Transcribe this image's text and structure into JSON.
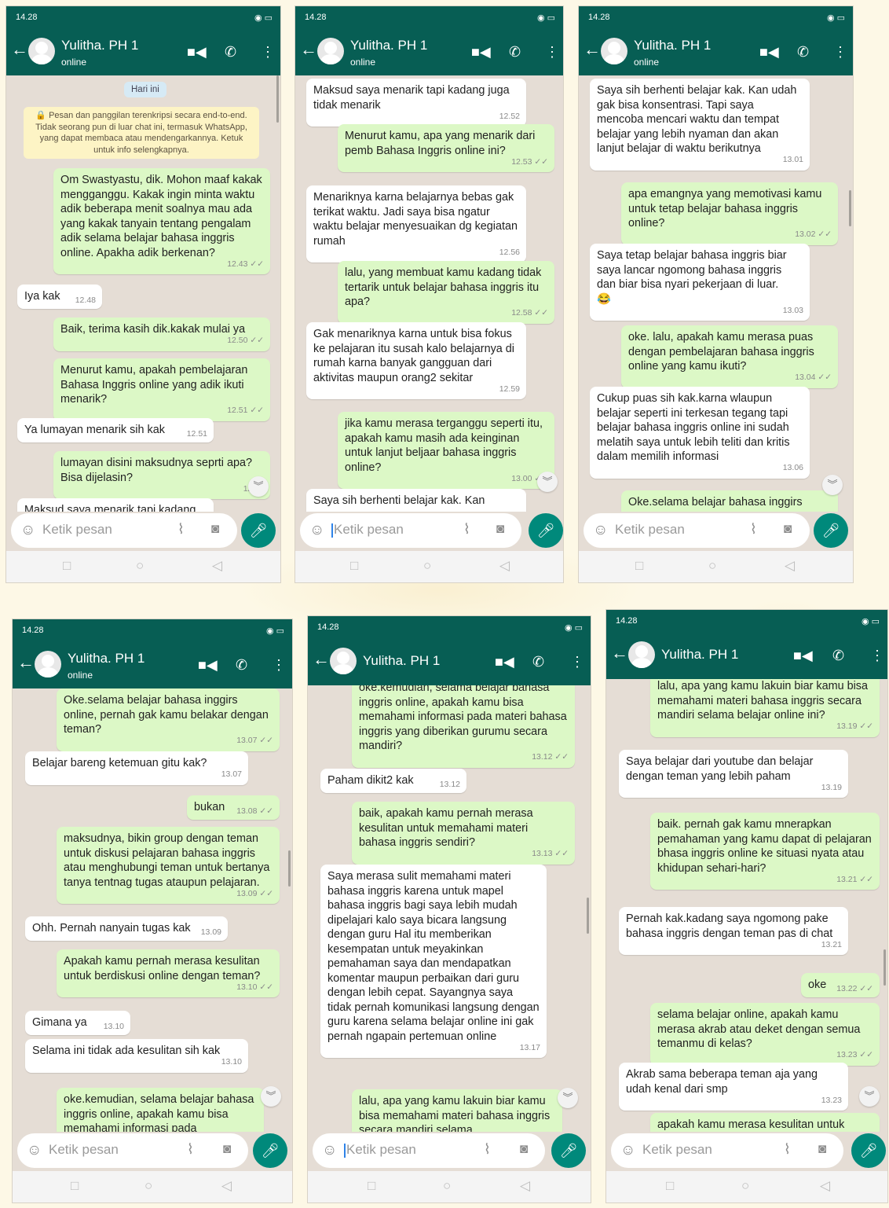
{
  "colors": {
    "header": "#075e54",
    "outgoing": "#dcf8c6",
    "incoming": "#ffffff",
    "chat_bg": "#e5ddd5",
    "mic": "#00897b"
  },
  "icons": {
    "back": "arrow-left-icon",
    "video": "video-camera-icon",
    "call": "phone-icon",
    "menu": "vertical-dots-icon",
    "emoji": "emoji-icon",
    "attach": "paperclip-icon",
    "camera": "camera-icon",
    "mic": "microphone-icon"
  },
  "contact": {
    "name": "Yulitha. PH 1",
    "status": "online"
  },
  "status_time": "14.28",
  "input_placeholder": "Ketik pesan",
  "screens": [
    {
      "messages": [
        {
          "dir": "in",
          "text": "Iya kak",
          "time": "12.48"
        },
        {
          "dir": "out",
          "text": "Om Swastyastu, dik. Mohon maaf kakak mengganggu. Kakak ingin minta waktu adik beberapa menit soalnya mau ada yang kakak tanyain tentang pengalam adik selama belajar bahasa inggris online. Apakha adik berkenan?",
          "time": "12.43 ✓✓"
        },
        {
          "dir": "out",
          "text": "Baik, terima kasih dik.kakak mulai ya",
          "time": "12.50 ✓✓"
        },
        {
          "dir": "out",
          "text": "Menurut kamu, apakah pembelajaran Bahasa Inggris online yang adik ikuti menarik?",
          "time": "12.51 ✓✓"
        },
        {
          "dir": "in",
          "text": "Ya lumayan menarik sih kak",
          "time": "12.51"
        },
        {
          "dir": "out",
          "text": "lumayan disini maksudnya seprti apa? Bisa dijelasin?",
          "time": "12.52"
        },
        {
          "dir": "in",
          "text": "Maksud saya menarik tapi kadang",
          "time": ""
        }
      ],
      "date_chip": "Hari ini",
      "notice": "🔒 Pesan dan panggilan terenkripsi secara end-to-end. Tidak seorang pun di luar chat ini, termasuk WhatsApp, yang dapat membaca atau mendengarkannya. Ketuk untuk info selengkapnya."
    },
    {
      "messages": [
        {
          "dir": "in",
          "text": "Maksud saya menarik tapi kadang juga tidak menarik",
          "time": "12.52"
        },
        {
          "dir": "out",
          "text": "Menurut kamu, apa yang menarik dari pemb Bahasa Inggris online ini?",
          "time": "12.53 ✓✓"
        },
        {
          "dir": "in",
          "text": "Menariknya karna belajarnya bebas gak terikat waktu. Jadi saya bisa ngatur waktu belajar menyesuaikan dg kegiatan rumah",
          "time": "12.56"
        },
        {
          "dir": "out",
          "text": "lalu, yang membuat kamu kadang tidak tertarik untuk belajar bahasa inggris itu apa?",
          "time": "12.58 ✓✓"
        },
        {
          "dir": "in",
          "text": "Gak menariknya karna untuk bisa fokus ke pelajaran itu susah kalo belajarnya di rumah karna banyak gangguan dari aktivitas maupun orang2 sekitar",
          "time": "12.59"
        },
        {
          "dir": "out",
          "text": "jika kamu merasa terganggu seperti itu, apakah kamu masih ada keinginan untuk lanjut beljaar bahasa inggris online?",
          "time": "13.00 ✓✓"
        },
        {
          "dir": "in",
          "text": "Saya sih berhenti belajar kak. Kan",
          "time": ""
        }
      ]
    },
    {
      "messages": [
        {
          "dir": "in",
          "text": "Saya sih berhenti belajar kak. Kan udah gak bisa konsentrasi. Tapi saya mencoba mencari waktu dan tempat belajar yang lebih nyaman dan akan lanjut belajar di waktu berikutnya",
          "time": "13.01"
        },
        {
          "dir": "out",
          "text": "apa emangnya yang memotivasi kamu untuk tetap belajar bahasa inggris online?",
          "time": "13.02 ✓✓"
        },
        {
          "dir": "in",
          "text": "Saya tetap belajar bahasa inggris biar saya lancar ngomong bahasa inggris dan biar bisa nyari pekerjaan di luar.",
          "emoji": "😂",
          "time": "13.03"
        },
        {
          "dir": "out",
          "text": "oke. lalu, apakah kamu merasa puas dengan pembelajaran bahasa inggris online yang kamu ikuti?",
          "time": "13.04 ✓✓"
        },
        {
          "dir": "in",
          "text": "Cukup puas sih kak.karna  wlaupun belajar seperti ini terkesan tegang tapi belajar bahasa inggris online ini sudah melatih saya untuk lebih teliti dan kritis dalam memilih informasi",
          "time": "13.06"
        },
        {
          "dir": "out",
          "text": "Oke.selama belajar bahasa inggirs",
          "time": ""
        }
      ]
    },
    {
      "messages": [
        {
          "dir": "out",
          "text": "Oke.selama belajar bahasa inggirs online, pernah gak kamu belakar dengan teman?",
          "time": "13.07 ✓✓"
        },
        {
          "dir": "in",
          "text": "Belajar bareng ketemuan gitu kak?",
          "time": "13.07"
        },
        {
          "dir": "out",
          "text": "bukan",
          "time": "13.08 ✓✓"
        },
        {
          "dir": "out",
          "text": "maksudnya, bikin group dengan teman untuk diskusi pelajaran bahasa inggris atau menghubungi teman untuk bertanya tanya tentnag tugas ataupun pelajaran.",
          "time": "13.09 ✓✓"
        },
        {
          "dir": "in",
          "text": "Ohh. Pernah nanyain tugas kak",
          "time": "13.09"
        },
        {
          "dir": "out",
          "text": "Apakah kamu pernah merasa kesulitan untuk berdiskusi online dengan teman?",
          "time": "13.10 ✓✓"
        },
        {
          "dir": "in",
          "text": "Gimana ya",
          "time": "13.10"
        },
        {
          "dir": "in",
          "text": "Selama ini tidak ada kesulitan sih kak",
          "time": "13.10"
        },
        {
          "dir": "out",
          "text": "oke.kemudian, selama belajar bahasa inggris online, apakah kamu bisa memahami informasi pada",
          "time": ""
        }
      ]
    },
    {
      "messages": [
        {
          "dir": "out",
          "text": "oke.kemudian, selama belajar bahasa inggris online, apakah kamu bisa memahami informasi pada materi bahasa inggris yang diberikan gurumu secara mandiri?",
          "time": "13.12 ✓✓"
        },
        {
          "dir": "in",
          "text": "Paham dikit2 kak",
          "time": "13.12"
        },
        {
          "dir": "out",
          "text": "baik, apakah kamu pernah merasa kesulitan untuk memahami materi bahasa inggris sendiri?",
          "time": "13.13 ✓✓"
        },
        {
          "dir": "in",
          "text": "Saya merasa sulit memahami materi bahasa inggris karena untuk mapel bahasa inggris bagi saya lebih mudah dipelajari kalo saya bicara langsung dengan guru Hal itu memberikan kesempatan untuk meyakinkan pemahaman saya dan mendapatkan komentar maupun perbaikan dari guru dengan lebih cepat. Sayangnya saya tidak pernah komunikasi langsung dengan guru karena selama belajar online ini gak pernah ngapain pertemuan online",
          "time": "13.17"
        },
        {
          "dir": "out",
          "text": "lalu, apa yang kamu lakuin biar kamu bisa memahami materi bahasa inggris secara mandiri selama",
          "time": ""
        }
      ]
    },
    {
      "messages": [
        {
          "dir": "out",
          "text": "lalu, apa yang kamu lakuin biar kamu bisa memahami materi bahasa inggris secara mandiri selama belajar online ini?",
          "time": "13.19 ✓✓"
        },
        {
          "dir": "in",
          "text": "Saya belajar dari youtube  dan belajar dengan teman yang lebih paham",
          "time": "13.19"
        },
        {
          "dir": "out",
          "text": "baik. pernah gak kamu mnerapkan pemahaman yang kamu dapat di pelajaran bhasa inggris online ke situasi nyata atau khidupan sehari-hari?",
          "time": "13.21 ✓✓"
        },
        {
          "dir": "in",
          "text": "Pernah kak.kadang saya ngomong pake bahasa inggris dengan teman pas di chat",
          "time": "13.21"
        },
        {
          "dir": "out",
          "text": "oke",
          "time": "13.22 ✓✓"
        },
        {
          "dir": "out",
          "text": "selama belajar online, apakah kamu merasa akrab atau deket dengan semua temanmu di kelas?",
          "time": "13.23 ✓✓"
        },
        {
          "dir": "in",
          "text": "Akrab sama beberapa teman aja yang udah kenal dari smp",
          "time": "13.23"
        },
        {
          "dir": "out",
          "text": "apakah kamu merasa kesulitan untuk",
          "time": ""
        }
      ]
    }
  ]
}
